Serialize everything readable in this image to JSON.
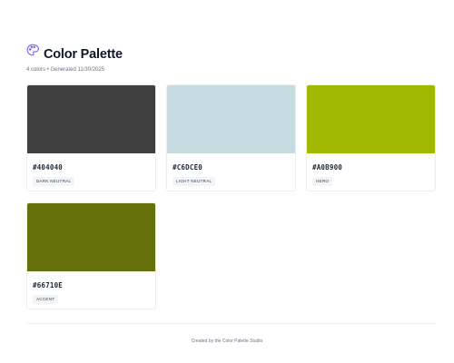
{
  "header": {
    "icon": "palette-icon",
    "title": "Color Palette",
    "subtitle": "4 colors • Generated 11/30/2025"
  },
  "colors": [
    {
      "hex": "#404040",
      "role": "DARK NEUTRAL"
    },
    {
      "hex": "#C6DCE0",
      "role": "LIGHT NEUTRAL"
    },
    {
      "hex": "#A0B900",
      "role": "HERO"
    },
    {
      "hex": "#66710E",
      "role": "ACCENT"
    }
  ],
  "footer": {
    "text": "Created by the Color Palette Studio"
  }
}
